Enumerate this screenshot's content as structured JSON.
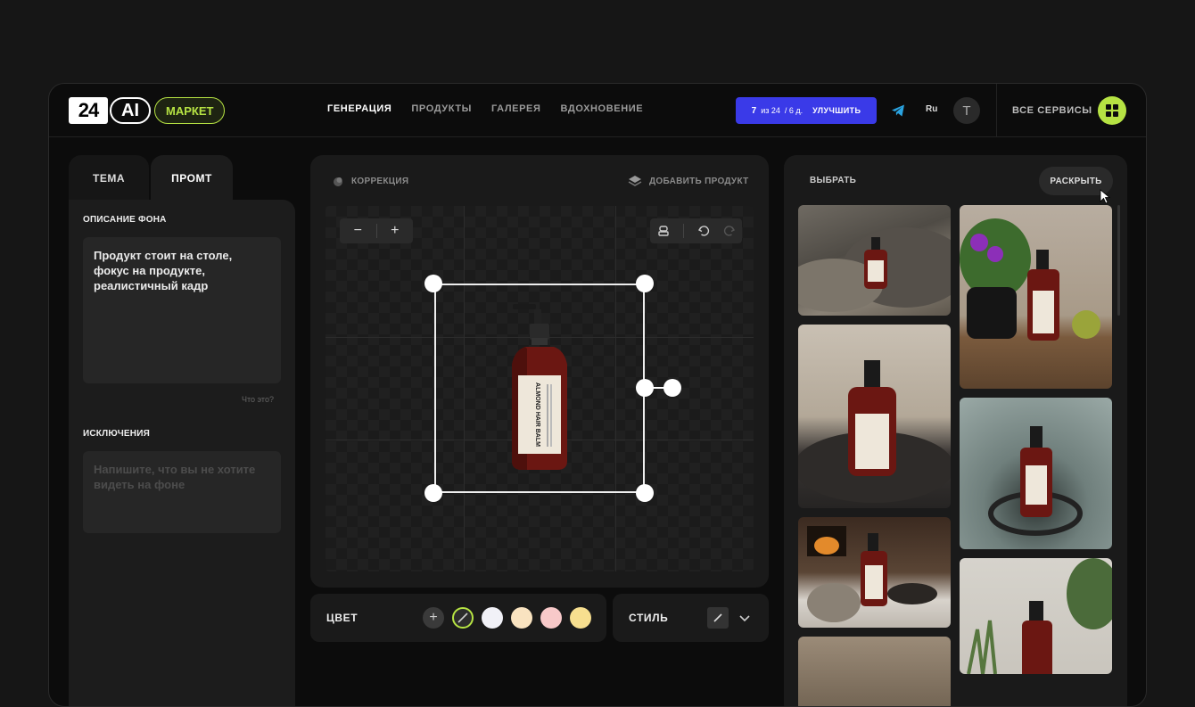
{
  "header": {
    "logo": {
      "num": "24",
      "ai": "AI",
      "market": "МАРКЕТ"
    },
    "nav": [
      "ГЕНЕРАЦИЯ",
      "ПРОДУКТЫ",
      "ГАЛЕРЕЯ",
      "ВДОХНОВЕНИЕ"
    ],
    "limit": {
      "count": "7",
      "of": "из 24",
      "period": "/ 6 д.",
      "upgrade": "УЛУЧШИТЬ"
    },
    "lang": "Ru",
    "avatar": "T",
    "all_services": "ВСЕ СЕРВИСЫ"
  },
  "left": {
    "tabs": [
      "ТЕМА",
      "ПРОМТ"
    ],
    "bg_label": "ОПИСАНИЕ ФОНА",
    "bg_value": "Продукт стоит на столе, фокус на продукте, реалистичный кадр",
    "what_is": "Что это?",
    "exclusions_label": "ИСКЛЮЧЕНИЯ",
    "exclusions_placeholder": "Напишите, что вы не хотите видеть на фоне"
  },
  "center": {
    "correction": "КОРРЕКЦИЯ",
    "add_product": "ДОБАВИТЬ ПРОДУКТ",
    "product_label": "ALMOND HAIR BALM"
  },
  "bottom": {
    "color_label": "ЦВЕТ",
    "swatches": [
      "#f1f1f7",
      "#f9e3c0",
      "#f8c9c9",
      "#f7df8f"
    ],
    "style_label": "СТИЛЬ"
  },
  "gallery": {
    "select": "ВЫБРАТЬ",
    "reveal": "РАСКРЫТЬ"
  },
  "colors": {
    "accent": "#b6e343",
    "brand_blue": "#3a3ae8"
  }
}
